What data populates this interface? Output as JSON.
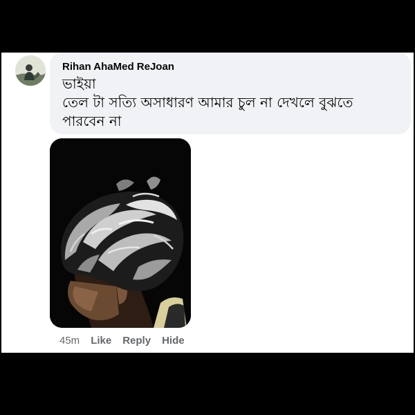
{
  "comment": {
    "author": "Rihan AhaMed ReJoan",
    "text": "ভাইয়া\nতেল টা সত্যি অসাধারণ আমার চুল না দেখলে বুঝতে\nপারবেন না",
    "avatar_icon": "profile-avatar-photo",
    "attachment_icon": "photo-hair-back-of-head",
    "timestamp": "45m",
    "actions": {
      "like": "Like",
      "reply": "Reply",
      "hide": "Hide"
    }
  },
  "colors": {
    "bubble": "#f0f2f5",
    "secondary_text": "#65676b",
    "primary_text": "#050505",
    "outer_background": "#000000"
  }
}
